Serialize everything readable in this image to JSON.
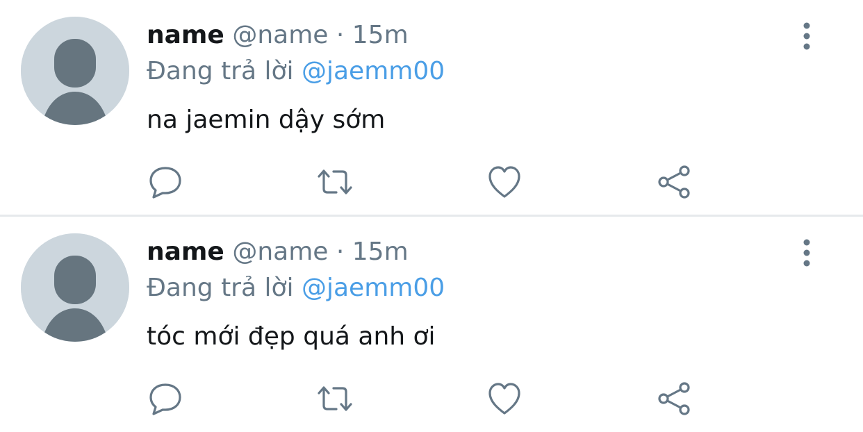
{
  "tweets": [
    {
      "display_name": "name",
      "handle": "@name",
      "separator": "·",
      "time": "15m",
      "reply_prefix": "Đang trả lời",
      "reply_mention": "@jaemm00",
      "text": "na jaemin dậy sớm",
      "avatar_icon": "default-profile-avatar",
      "more_icon": "more-vertical-icon",
      "actions": {
        "reply_icon": "reply-icon",
        "retweet_icon": "retweet-icon",
        "like_icon": "heart-icon",
        "share_icon": "share-icon"
      }
    },
    {
      "display_name": "name",
      "handle": "@name",
      "separator": "·",
      "time": "15m",
      "reply_prefix": "Đang trả lời",
      "reply_mention": "@jaemm00",
      "text": "tóc mới đẹp quá anh ơi",
      "avatar_icon": "default-profile-avatar",
      "more_icon": "more-vertical-icon",
      "actions": {
        "reply_icon": "reply-icon",
        "retweet_icon": "retweet-icon",
        "like_icon": "heart-icon",
        "share_icon": "share-icon"
      }
    }
  ],
  "colors": {
    "text_primary": "#14171a",
    "text_secondary": "#657786",
    "mention": "#4a9ee6",
    "avatar_bg": "#ccd6dd",
    "avatar_fg": "#66757f",
    "divider": "#e6e9ec",
    "icon": "#657786"
  }
}
